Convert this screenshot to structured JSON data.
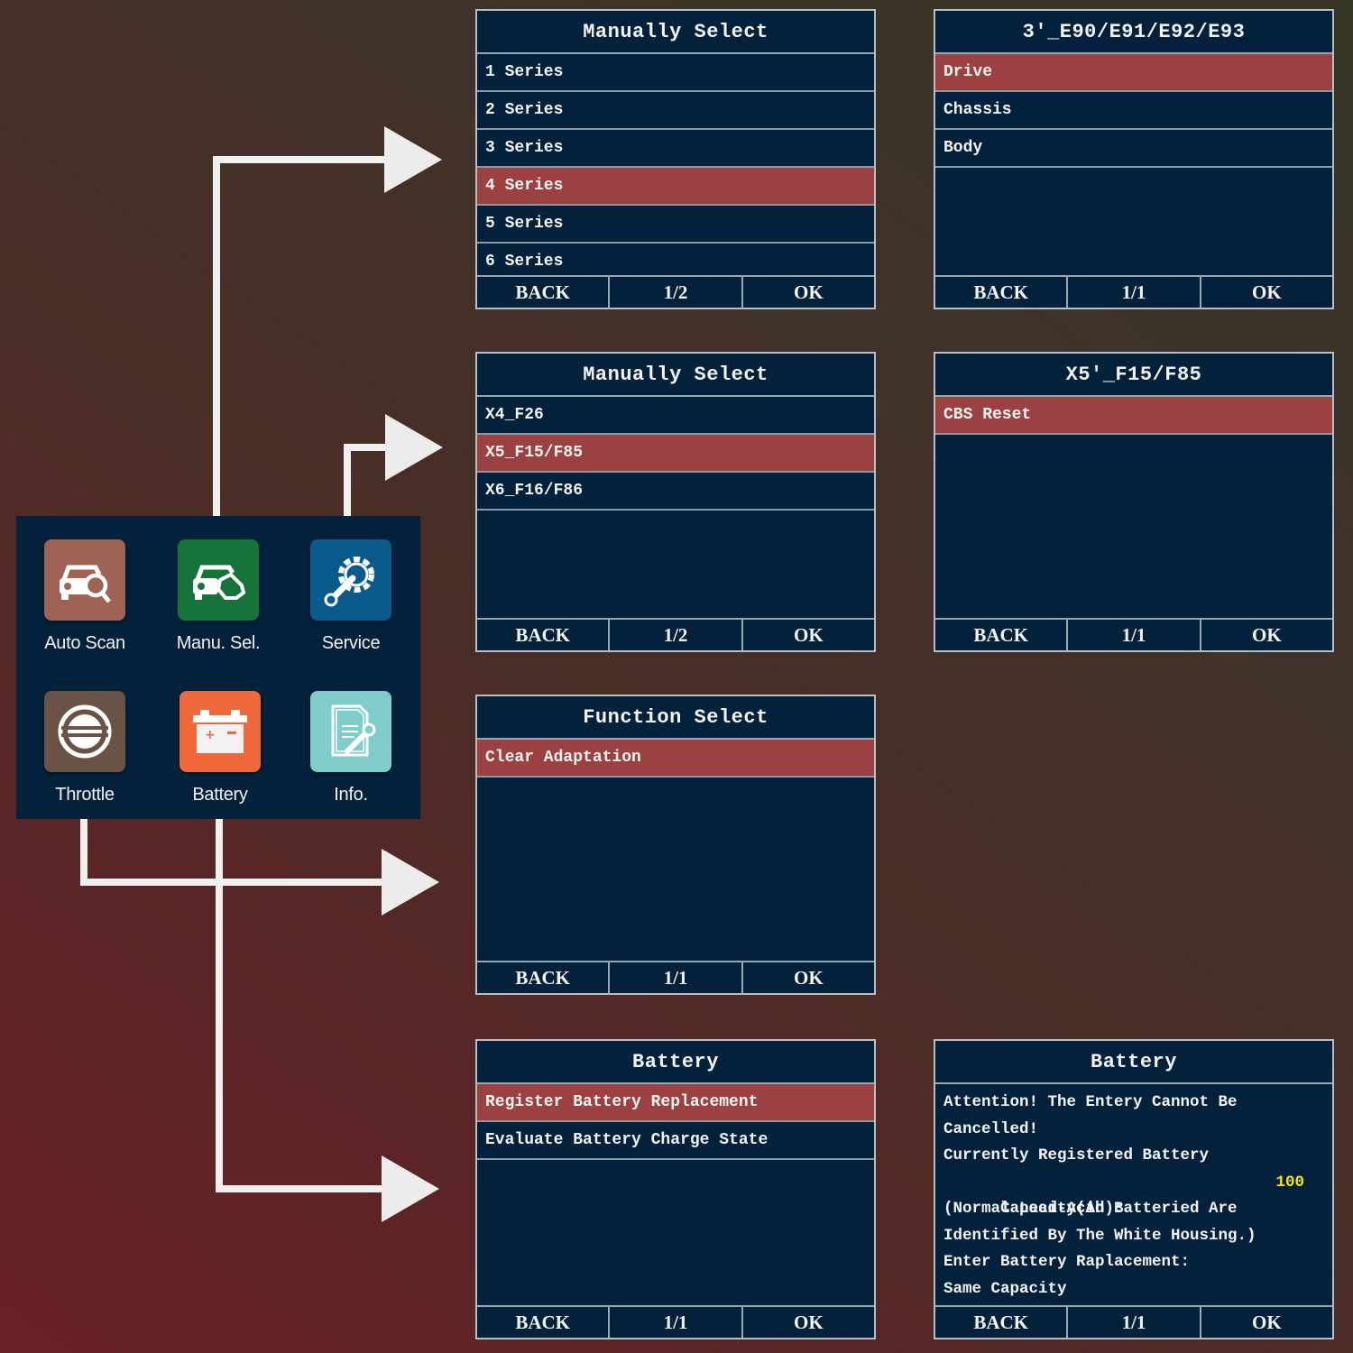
{
  "home_menu": {
    "tiles": [
      {
        "label": "Auto Scan",
        "icon": "car-search-icon",
        "color": "#9e6355"
      },
      {
        "label": "Manu. Sel.",
        "icon": "car-hand-icon",
        "color": "#16743a"
      },
      {
        "label": "Service",
        "icon": "gear-wrench-icon",
        "color": "#0b5a8c"
      },
      {
        "label": "Throttle",
        "icon": "throttle-icon",
        "color": "#6a5246"
      },
      {
        "label": "Battery",
        "icon": "battery-icon",
        "color": "#ef683a"
      },
      {
        "label": "Info.",
        "icon": "document-wrench-icon",
        "color": "#7fcccb"
      }
    ]
  },
  "colors": {
    "screen_bg": "#03213b",
    "selected_row": "#9b4142",
    "highlight_value": "#f5e700",
    "arrow": "#f0f0f0"
  },
  "screens": {
    "manual_select_series": {
      "title": "Manually Select",
      "rows": [
        "1 Series",
        "2 Series",
        "3 Series",
        "4 Series",
        "5 Series",
        "6 Series"
      ],
      "selected_index": 3,
      "footer": {
        "back": "BACK",
        "page": "1/2",
        "ok": "OK"
      }
    },
    "e90_systems": {
      "title": "3′_E90/E91/E92/E93",
      "rows": [
        "Drive",
        "Chassis",
        "Body"
      ],
      "selected_index": 0,
      "footer": {
        "back": "BACK",
        "page": "1/1",
        "ok": "OK"
      }
    },
    "manual_select_x": {
      "title": "Manually Select",
      "rows": [
        "X4_F26",
        "X5_F15/F85",
        "X6_F16/F86"
      ],
      "selected_index": 1,
      "footer": {
        "back": "BACK",
        "page": "1/2",
        "ok": "OK"
      }
    },
    "x5_service": {
      "title": "X5′_F15/F85",
      "rows": [
        "CBS Reset"
      ],
      "selected_index": 0,
      "footer": {
        "back": "BACK",
        "page": "1/1",
        "ok": "OK"
      }
    },
    "function_select": {
      "title": "Function Select",
      "rows": [
        "Clear Adaptation"
      ],
      "selected_index": 0,
      "footer": {
        "back": "BACK",
        "page": "1/1",
        "ok": "OK"
      }
    },
    "battery_menu": {
      "title": "Battery",
      "rows": [
        "Register Battery Replacement",
        "Evaluate Battery Charge State"
      ],
      "selected_index": 0,
      "footer": {
        "back": "BACK",
        "page": "1/1",
        "ok": "OK"
      }
    },
    "battery_message": {
      "title": "Battery",
      "lines": [
        "Attention! The Entery Cannot Be",
        "Cancelled!",
        "Currently Registered Battery",
        "Capacity(Ah):",
        "(Normal Lead-Acid Batteried Are",
        "Identified By The White Housing.)",
        "Enter Battery Raplacement:",
        "Same Capacity"
      ],
      "capacity_value": "100",
      "footer": {
        "back": "BACK",
        "page": "1/1",
        "ok": "OK"
      }
    }
  }
}
